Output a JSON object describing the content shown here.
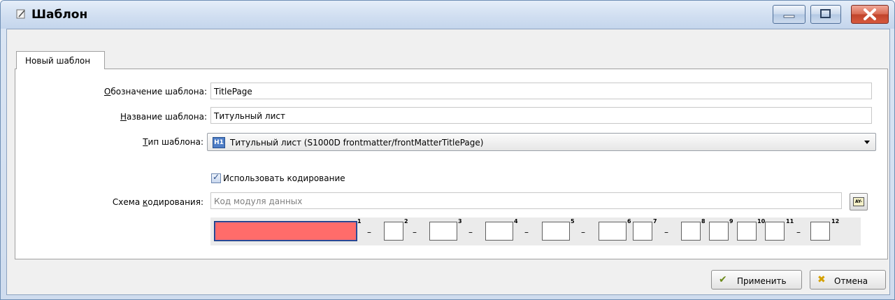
{
  "window": {
    "title": "Шаблон"
  },
  "tabs": [
    {
      "label": "Новый шаблон"
    }
  ],
  "form": {
    "designation": {
      "label_accel": "О",
      "label_rest": "бозначение шаблона:",
      "value": "TitlePage"
    },
    "name": {
      "label_accel": "Н",
      "label_rest": "азвание шаблона:",
      "value": "Титульный лист"
    },
    "type": {
      "label_accel": "Т",
      "label_rest": "ип шаблона:",
      "icon_text": "H1",
      "value": "Титульный лист (S1000D frontmatter/frontMatterTitlePage)"
    },
    "use_coding": {
      "label": "Использовать кодирование",
      "checked": true
    },
    "scheme": {
      "label_prefix": "Схема ",
      "label_accel": "к",
      "label_rest": "одирования:",
      "placeholder": "Код модуля данных",
      "button_text": "AY-"
    },
    "code_segments": [
      "1",
      "2",
      "3",
      "4",
      "5",
      "6",
      "7",
      "8",
      "9",
      "10",
      "11",
      "12"
    ],
    "separator": "–"
  },
  "buttons": {
    "apply": "Применить",
    "cancel": "Отмена"
  },
  "colors": {
    "active_segment": "#ff6c6a",
    "titlebar": "#d4e1f2",
    "close_button": "#c0442b"
  }
}
